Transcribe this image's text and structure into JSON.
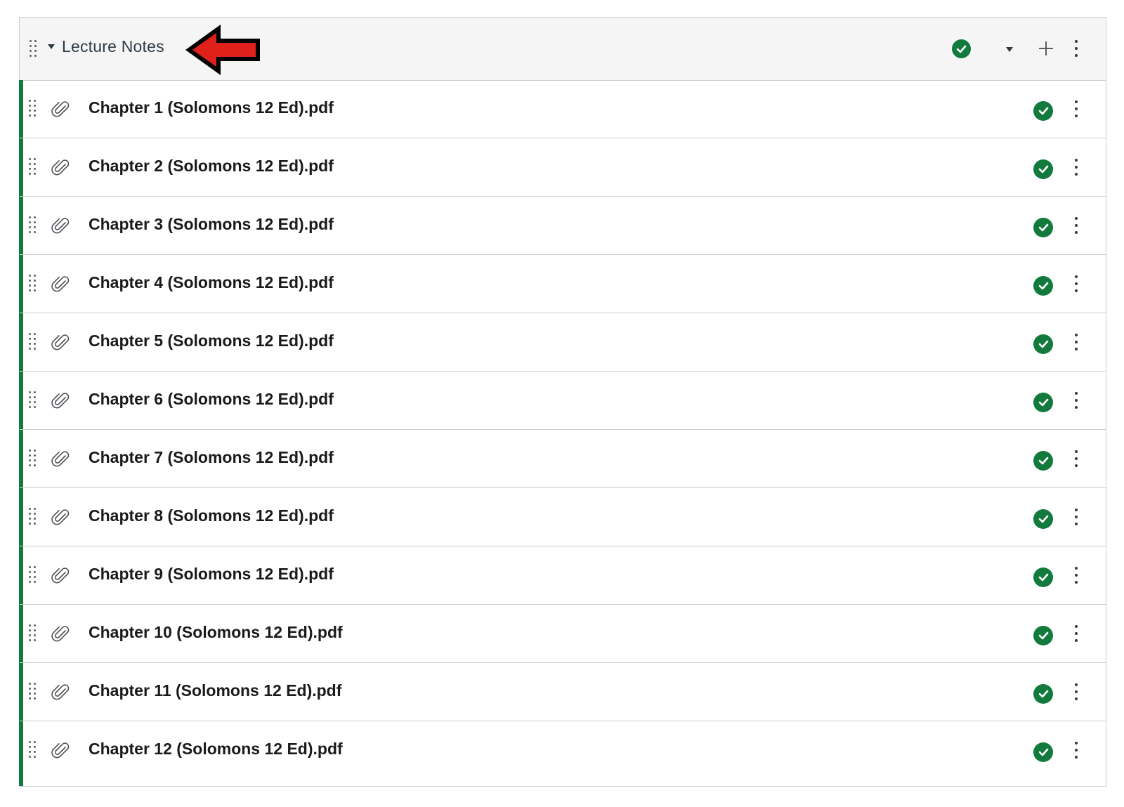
{
  "module": {
    "title": "Lecture Notes",
    "status": "published",
    "accent_color": "#127a3d",
    "annotation_arrow_color": "#e0201b"
  },
  "icons": {
    "drag": "drag-handle-icon",
    "collapse": "caret-down-icon",
    "publish": "check-circle-icon",
    "add": "plus-icon",
    "menu": "kebab-menu-icon",
    "attachment": "paperclip-icon"
  },
  "items": [
    {
      "title": "Chapter 1 (Solomons 12 Ed).pdf",
      "status": "published"
    },
    {
      "title": "Chapter 2 (Solomons 12 Ed).pdf",
      "status": "published"
    },
    {
      "title": "Chapter 3 (Solomons 12 Ed).pdf",
      "status": "published"
    },
    {
      "title": "Chapter 4 (Solomons 12 Ed).pdf",
      "status": "published"
    },
    {
      "title": "Chapter 5 (Solomons 12 Ed).pdf",
      "status": "published"
    },
    {
      "title": "Chapter 6 (Solomons 12 Ed).pdf",
      "status": "published"
    },
    {
      "title": "Chapter 7 (Solomons 12 Ed).pdf",
      "status": "published"
    },
    {
      "title": "Chapter 8 (Solomons 12 Ed).pdf",
      "status": "published"
    },
    {
      "title": "Chapter 9 (Solomons 12 Ed).pdf",
      "status": "published"
    },
    {
      "title": "Chapter 10 (Solomons 12 Ed).pdf",
      "status": "published"
    },
    {
      "title": "Chapter 11 (Solomons 12 Ed).pdf",
      "status": "published"
    },
    {
      "title": "Chapter 12 (Solomons 12 Ed).pdf",
      "status": "published"
    }
  ]
}
